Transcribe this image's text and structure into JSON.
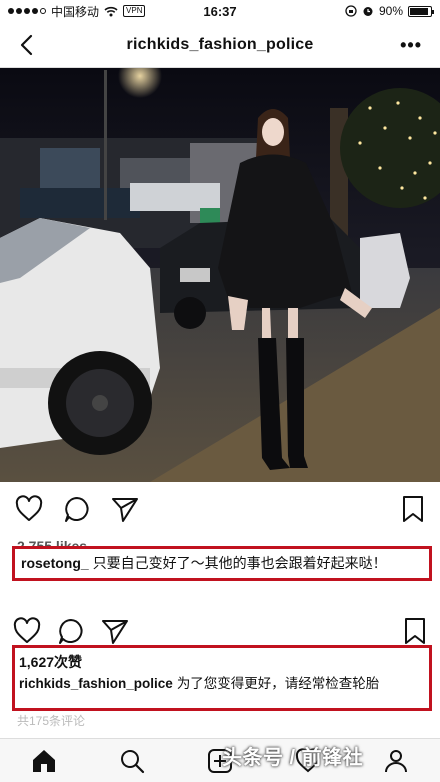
{
  "status_bar": {
    "carrier": "中国移动",
    "vpn": "VPN",
    "time": "16:37",
    "battery": "90%",
    "battery_level": 0.9
  },
  "nav": {
    "title": "richkids_fashion_police",
    "back_icon": "back-chevron-icon",
    "more_icon": "more-dots-icon",
    "more_label": "•••"
  },
  "post1": {
    "likes": "2,755 likes",
    "username": "rosetong_",
    "caption": "只要自己变好了～其他的事也会跟着好起来哒！",
    "icons": [
      "heart-icon",
      "comment-icon",
      "send-icon",
      "bookmark-icon"
    ]
  },
  "post2": {
    "likes": "1,627次赞",
    "username": "richkids_fashion_police",
    "caption": "为了您变得更好，请经常检查轮胎",
    "comments": "共175条评论",
    "icons": [
      "heart-icon",
      "comment-icon",
      "send-icon",
      "bookmark-icon"
    ]
  },
  "tab_bar": {
    "icons": [
      "home-icon",
      "search-icon",
      "add-icon",
      "heart-icon",
      "profile-icon"
    ]
  },
  "watermark": "头条号 / 前锋社",
  "colors": {
    "highlight_border": "#c1121f",
    "text": "#111111"
  }
}
